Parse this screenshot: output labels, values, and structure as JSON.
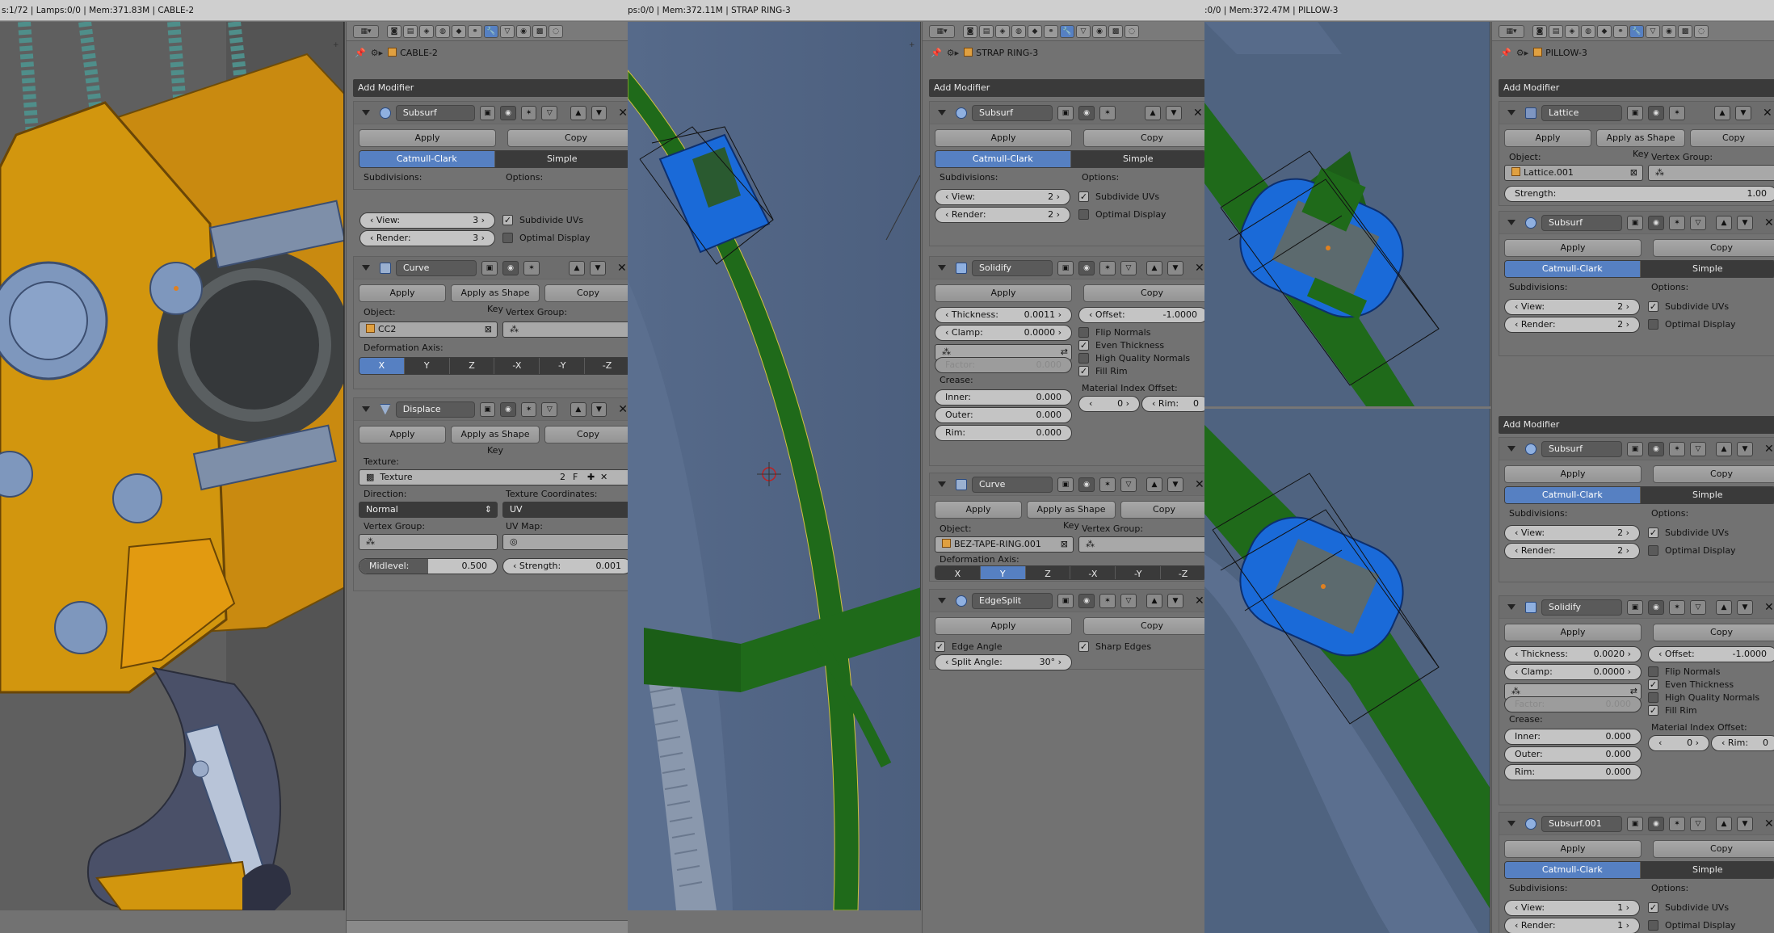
{
  "frame1": {
    "status": "s:1/72 | Lamps:0/0 | Mem:371.83M | CABLE-2",
    "object": "CABLE-2",
    "add_modifier": "Add Modifier",
    "subsurf": {
      "name": "Subsurf",
      "apply": "Apply",
      "copy": "Copy",
      "mode_a": "Catmull-Clark",
      "mode_b": "Simple",
      "subdiv_label": "Subdivisions:",
      "options_label": "Options:",
      "view_label": "View:",
      "view": "3",
      "render_label": "Render:",
      "render": "3",
      "opt1": "Subdivide UVs",
      "opt2": "Optimal Display"
    },
    "curve": {
      "name": "Curve",
      "apply": "Apply",
      "apply_shape": "Apply as Shape Key",
      "copy": "Copy",
      "object_label": "Object:",
      "object": "CC2",
      "vgroup_label": "Vertex Group:",
      "axis_label": "Deformation Axis:",
      "axes": [
        "X",
        "Y",
        "Z",
        "-X",
        "-Y",
        "-Z"
      ]
    },
    "displace": {
      "name": "Displace",
      "apply": "Apply",
      "apply_shape": "Apply as Shape Key",
      "copy": "Copy",
      "texture_label": "Texture:",
      "texture": "Texture",
      "tex_users": "2",
      "tex_f": "F",
      "direction_label": "Direction:",
      "direction": "Normal",
      "texcoords_label": "Texture Coordinates:",
      "texcoords": "UV",
      "vgroup_label": "Vertex Group:",
      "uvmap_label": "UV Map:",
      "midlevel_label": "Midlevel:",
      "midlevel": "0.500",
      "strength_label": "Strength:",
      "strength": "0.001"
    }
  },
  "frame2": {
    "status": "ps:0/0 | Mem:372.11M | STRAP RING-3",
    "object": "STRAP RING-3",
    "add_modifier": "Add Modifier",
    "subsurf": {
      "name": "Subsurf",
      "apply": "Apply",
      "copy": "Copy",
      "mode_a": "Catmull-Clark",
      "mode_b": "Simple",
      "subdiv_label": "Subdivisions:",
      "options_label": "Options:",
      "view_label": "View:",
      "view": "2",
      "render_label": "Render:",
      "render": "2",
      "opt1": "Subdivide UVs",
      "opt2": "Optimal Display"
    },
    "solidify": {
      "name": "Solidify",
      "apply": "Apply",
      "copy": "Copy",
      "thickness_label": "Thickness:",
      "thickness": "0.0011",
      "offset_label": "Offset:",
      "offset": "-1.0000",
      "clamp_label": "Clamp:",
      "clamp": "0.0000",
      "flip": "Flip Normals",
      "even": "Even Thickness",
      "hq": "High Quality Normals",
      "fillrim": "Fill Rim",
      "factor_label": "Factor:",
      "factor": "0.000",
      "crease_label": "Crease:",
      "inner_label": "Inner:",
      "inner": "0.000",
      "outer_label": "Outer:",
      "outer": "0.000",
      "rim_label": "Rim:",
      "rim": "0.000",
      "matidx_label": "Material Index Offset:",
      "matidx": "0",
      "matrim_label": "Rim:",
      "matrim": "0"
    },
    "curve": {
      "name": "Curve",
      "apply": "Apply",
      "apply_shape": "Apply as Shape Key",
      "copy": "Copy",
      "object_label": "Object:",
      "object": "BEZ-TAPE-RING.001",
      "vgroup_label": "Vertex Group:",
      "axis_label": "Deformation Axis:",
      "axes": [
        "X",
        "Y",
        "Z",
        "-X",
        "-Y",
        "-Z"
      ]
    },
    "edgesplit": {
      "name": "EdgeSplit",
      "apply": "Apply",
      "copy": "Copy",
      "edge_angle": "Edge Angle",
      "sharp_edges": "Sharp Edges",
      "split_label": "Split Angle:",
      "split": "30°"
    }
  },
  "frame3": {
    "status": ":0/0 | Mem:372.47M | PILLOW-3",
    "object": "PILLOW-3",
    "add_modifier": "Add Modifier",
    "lattice": {
      "name": "Lattice",
      "apply": "Apply",
      "apply_shape": "Apply as Shape Key",
      "copy": "Copy",
      "object_label": "Object:",
      "object": "Lattice.001",
      "vgroup_label": "Vertex Group:",
      "strength_label": "Strength:",
      "strength": "1.00"
    },
    "subsurf_a": {
      "name": "Subsurf",
      "apply": "Apply",
      "copy": "Copy",
      "mode_a": "Catmull-Clark",
      "mode_b": "Simple",
      "subdiv_label": "Subdivisions:",
      "options_label": "Options:",
      "view_label": "View:",
      "view": "2",
      "render_label": "Render:",
      "render": "2",
      "opt1": "Subdivide UVs",
      "opt2": "Optimal Display"
    },
    "add_modifier2": "Add Modifier",
    "subsurf_b": {
      "name": "Subsurf",
      "apply": "Apply",
      "copy": "Copy",
      "mode_a": "Catmull-Clark",
      "mode_b": "Simple",
      "subdiv_label": "Subdivisions:",
      "options_label": "Options:",
      "view_label": "View:",
      "view": "2",
      "render_label": "Render:",
      "render": "2",
      "opt1": "Subdivide UVs",
      "opt2": "Optimal Display"
    },
    "solidify": {
      "name": "Solidify",
      "apply": "Apply",
      "copy": "Copy",
      "thickness_label": "Thickness:",
      "thickness": "0.0020",
      "offset_label": "Offset:",
      "offset": "-1.0000",
      "clamp_label": "Clamp:",
      "clamp": "0.0000",
      "flip": "Flip Normals",
      "even": "Even Thickness",
      "hq": "High Quality Normals",
      "fillrim": "Fill Rim",
      "factor_label": "Factor:",
      "factor": "0.000",
      "crease_label": "Crease:",
      "inner_label": "Inner:",
      "inner": "0.000",
      "outer_label": "Outer:",
      "outer": "0.000",
      "rim_label": "Rim:",
      "rim": "0.000",
      "matidx_label": "Material Index Offset:",
      "matidx": "0",
      "matrim_label": "Rim:",
      "matrim": "0"
    },
    "subsurf_c": {
      "name": "Subsurf.001",
      "apply": "Apply",
      "copy": "Copy",
      "mode_a": "Catmull-Clark",
      "mode_b": "Simple",
      "subdiv_label": "Subdivisions:",
      "options_label": "Options:",
      "view_label": "View:",
      "view": "1",
      "render_label": "Render:",
      "render": "1",
      "opt1": "Subdivide UVs",
      "opt2": "Optimal Display"
    }
  },
  "colors": {
    "accent": "#5680c2",
    "strap": "#1f6a1a",
    "pillow": "#1a6ad8",
    "frame": "#d2960e",
    "viewport": "#4f5f80"
  }
}
